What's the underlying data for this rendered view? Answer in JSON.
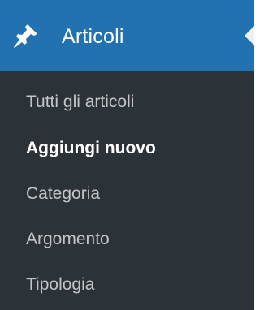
{
  "menu": {
    "title": "Articoli",
    "icon": "pushpin-icon",
    "colors": {
      "header_bg": "#2271b1",
      "menu_bg": "#2c3338",
      "text": "#c3c4c7",
      "active_text": "#ffffff"
    },
    "submenu": [
      {
        "label": "Tutti gli articoli",
        "current": false
      },
      {
        "label": "Aggiungi nuovo",
        "current": true
      },
      {
        "label": "Categoria",
        "current": false
      },
      {
        "label": "Argomento",
        "current": false
      },
      {
        "label": "Tipologia",
        "current": false
      }
    ]
  }
}
